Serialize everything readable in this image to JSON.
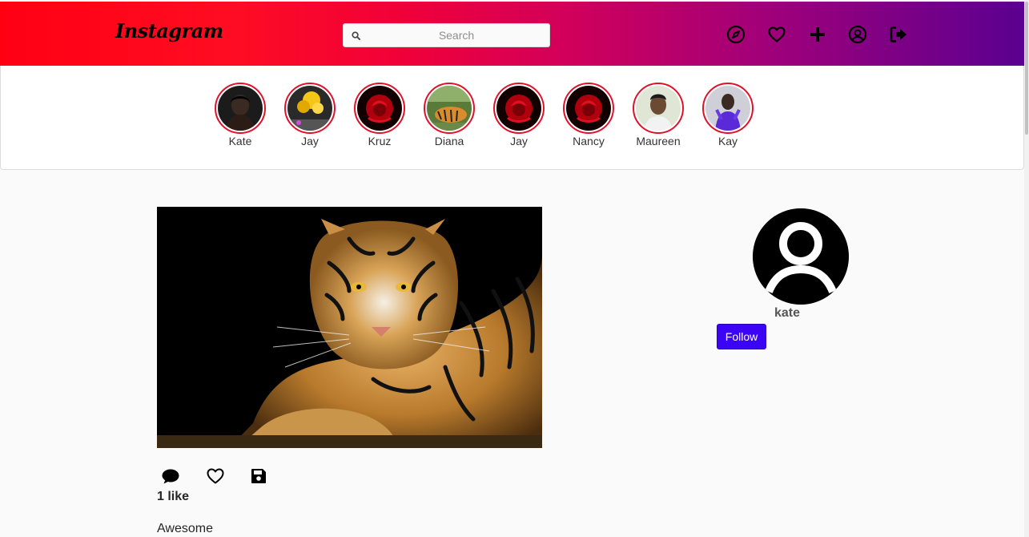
{
  "navbar": {
    "logo_text": "Instagram",
    "search": {
      "placeholder": "Search",
      "value": ""
    },
    "icons": [
      "compass-icon",
      "heart-icon",
      "plus-icon",
      "user-circle-icon",
      "sign-out-icon"
    ],
    "gradient_colors": [
      "#ff0013",
      "#d2005a",
      "#5a0090"
    ]
  },
  "stories": [
    {
      "name": "Kate",
      "avatar": "woman-portrait"
    },
    {
      "name": "Jay",
      "avatar": "yellow-balloons"
    },
    {
      "name": "Kruz",
      "avatar": "red-rose"
    },
    {
      "name": "Diana",
      "avatar": "tiger"
    },
    {
      "name": "Jay",
      "avatar": "red-rose"
    },
    {
      "name": "Nancy",
      "avatar": "red-rose"
    },
    {
      "name": "Maureen",
      "avatar": "woman-portrait"
    },
    {
      "name": "Kay",
      "avatar": "person-purple"
    }
  ],
  "post": {
    "image": "tiger-photo",
    "likes_text": "1 like",
    "caption": "Awesome",
    "action_icons": [
      "comment-icon",
      "heart-icon",
      "save-icon"
    ]
  },
  "profile": {
    "username": "kate",
    "follow_label": "Follow",
    "accent": "#3c04f4"
  }
}
